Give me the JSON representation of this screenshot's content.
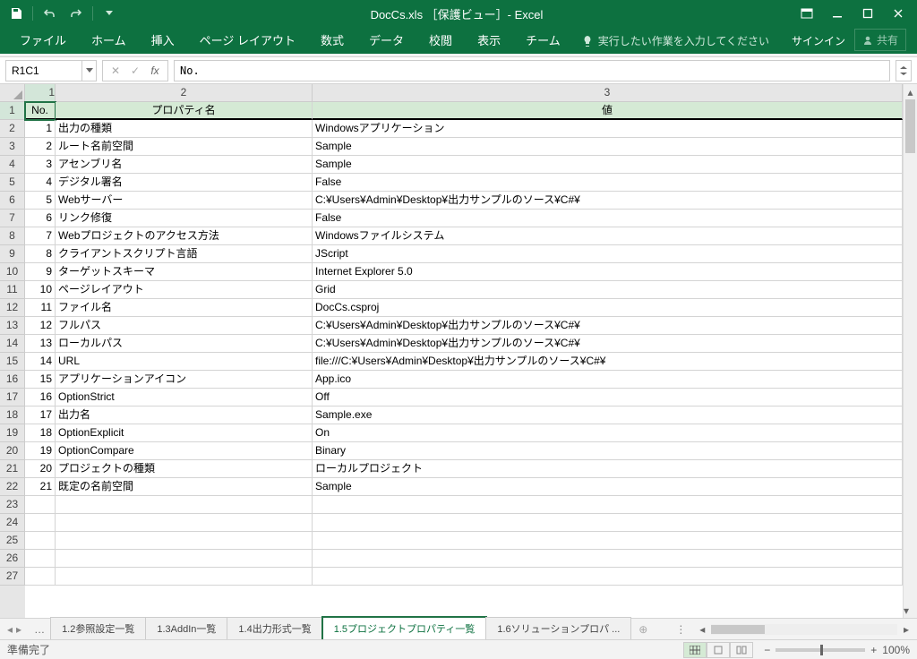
{
  "title": "DocCs.xls ［保護ビュー］- Excel",
  "ribbon": {
    "tabs": [
      "ファイル",
      "ホーム",
      "挿入",
      "ページ レイアウト",
      "数式",
      "データ",
      "校閲",
      "表示",
      "チーム"
    ],
    "tell": "実行したい作業を入力してください",
    "signin": "サインイン",
    "share": "共有"
  },
  "formula": {
    "namebox": "R1C1",
    "value": "No."
  },
  "colHeaders": [
    "1",
    "2",
    "3"
  ],
  "tableHeader": {
    "no": "No.",
    "prop": "プロパティ名",
    "val": "値"
  },
  "rows": [
    {
      "n": "1",
      "p": "出力の種類",
      "v": "Windowsアプリケーション"
    },
    {
      "n": "2",
      "p": "ルート名前空間",
      "v": "Sample"
    },
    {
      "n": "3",
      "p": "アセンブリ名",
      "v": "Sample"
    },
    {
      "n": "4",
      "p": "デジタル署名",
      "v": "False"
    },
    {
      "n": "5",
      "p": "Webサーバー",
      "v": "C:¥Users¥Admin¥Desktop¥出力サンプルのソース¥C#¥"
    },
    {
      "n": "6",
      "p": "リンク修復",
      "v": "False"
    },
    {
      "n": "7",
      "p": "Webプロジェクトのアクセス方法",
      "v": "Windowsファイルシステム"
    },
    {
      "n": "8",
      "p": "クライアントスクリプト言語",
      "v": "JScript"
    },
    {
      "n": "9",
      "p": "ターゲットスキーマ",
      "v": "Internet Explorer 5.0"
    },
    {
      "n": "10",
      "p": "ページレイアウト",
      "v": "Grid"
    },
    {
      "n": "11",
      "p": "ファイル名",
      "v": "DocCs.csproj"
    },
    {
      "n": "12",
      "p": "フルパス",
      "v": "C:¥Users¥Admin¥Desktop¥出力サンプルのソース¥C#¥"
    },
    {
      "n": "13",
      "p": "ローカルパス",
      "v": "C:¥Users¥Admin¥Desktop¥出力サンプルのソース¥C#¥"
    },
    {
      "n": "14",
      "p": "URL",
      "v": "file:///C:¥Users¥Admin¥Desktop¥出力サンプルのソース¥C#¥"
    },
    {
      "n": "15",
      "p": "アプリケーションアイコン",
      "v": "App.ico"
    },
    {
      "n": "16",
      "p": "OptionStrict",
      "v": "Off"
    },
    {
      "n": "17",
      "p": "出力名",
      "v": "Sample.exe"
    },
    {
      "n": "18",
      "p": "OptionExplicit",
      "v": "On"
    },
    {
      "n": "19",
      "p": "OptionCompare",
      "v": "Binary"
    },
    {
      "n": "20",
      "p": "プロジェクトの種類",
      "v": "ローカルプロジェクト"
    },
    {
      "n": "21",
      "p": "既定の名前空間",
      "v": "Sample"
    }
  ],
  "emptyRows": 5,
  "sheets": {
    "list": [
      "1.2参照設定一覧",
      "1.3AddIn一覧",
      "1.4出力形式一覧",
      "1.5プロジェクトプロパティ一覧",
      "1.6ソリューションプロパ ..."
    ],
    "active": 3
  },
  "status": {
    "ready": "準備完了",
    "zoom": "100%"
  }
}
